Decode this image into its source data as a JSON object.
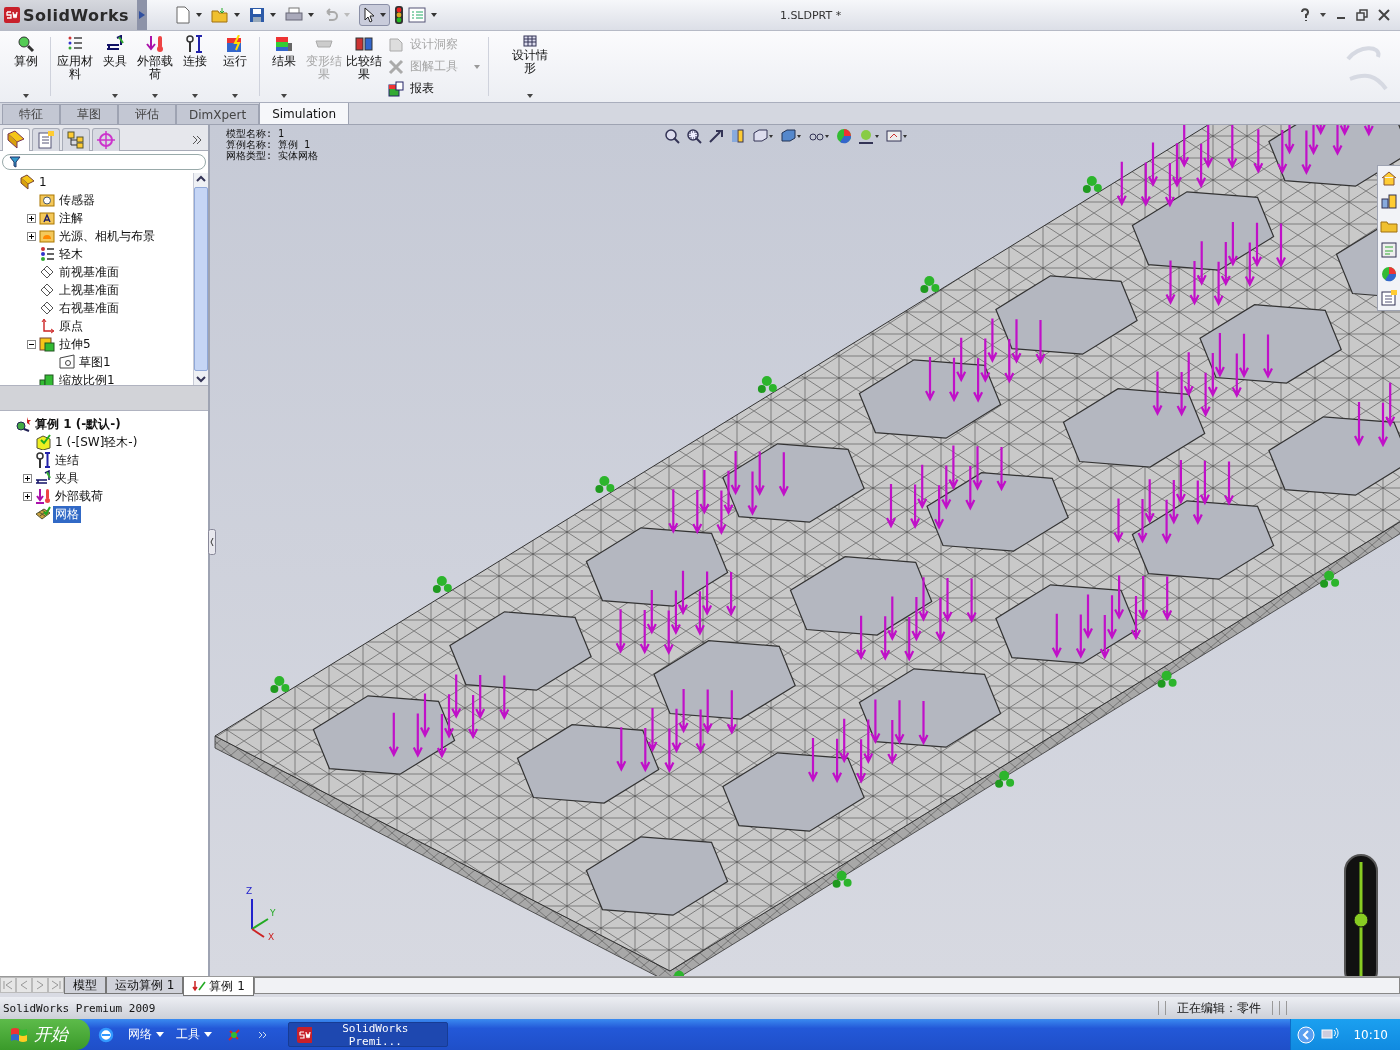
{
  "app": {
    "logo": "SolidWorks"
  },
  "window": {
    "title": "1.SLDPRT *"
  },
  "command_manager": {
    "large": [
      {
        "label": "算例",
        "dropdown": true,
        "disabled": false
      },
      {
        "label": "应用材料",
        "dropdown": false,
        "disabled": false
      },
      {
        "label": "夹具",
        "dropdown": true,
        "disabled": false
      },
      {
        "label": "外部载荷",
        "dropdown": true,
        "disabled": false
      },
      {
        "label": "连接",
        "dropdown": true,
        "disabled": false
      },
      {
        "label": "运行",
        "dropdown": true,
        "disabled": false
      },
      {
        "label": "结果",
        "dropdown": true,
        "disabled": false
      },
      {
        "label": "变形结果",
        "dropdown": false,
        "disabled": true
      },
      {
        "label": "比较结果",
        "dropdown": false,
        "disabled": false
      }
    ],
    "small": [
      {
        "label": "设计洞察",
        "dropdown": false,
        "disabled": true
      },
      {
        "label": "图解工具",
        "dropdown": true,
        "disabled": true
      },
      {
        "label": "报表",
        "dropdown": false,
        "disabled": false
      }
    ],
    "last": {
      "label": "设计情形",
      "dropdown": true,
      "disabled": false
    }
  },
  "tabs": [
    {
      "label": "特征",
      "selected": false
    },
    {
      "label": "草图",
      "selected": false
    },
    {
      "label": "评估",
      "selected": false
    },
    {
      "label": "DimXpert",
      "selected": false
    },
    {
      "label": "Simulation",
      "selected": true
    }
  ],
  "feature_tree": {
    "items": [
      {
        "label": "1",
        "kind": "part",
        "children": [
          {
            "label": "传感器",
            "kind": "sensor"
          },
          {
            "label": "注解",
            "kind": "annotation",
            "expanded": false
          },
          {
            "label": "光源、相机与布景",
            "kind": "lights",
            "expanded": false
          },
          {
            "label": "轻木",
            "kind": "material"
          },
          {
            "label": "前视基准面",
            "kind": "plane"
          },
          {
            "label": "上视基准面",
            "kind": "plane"
          },
          {
            "label": "右视基准面",
            "kind": "plane"
          },
          {
            "label": "原点",
            "kind": "origin"
          },
          {
            "label": "拉伸5",
            "kind": "extrude",
            "expanded": true,
            "children": [
              {
                "label": "草图1",
                "kind": "sketch"
              }
            ]
          },
          {
            "label": "缩放比例1",
            "kind": "scale"
          }
        ]
      }
    ]
  },
  "study_tree": {
    "items": [
      {
        "label": "算例 1 (-默认-)",
        "kind": "study",
        "selected": false,
        "children": [
          {
            "label": "1 (-[SW]轻木-)",
            "kind": "part",
            "selected": false
          },
          {
            "label": "连结",
            "kind": "connection",
            "selected": false
          },
          {
            "label": "夹具",
            "kind": "fixture",
            "expanded": false,
            "selected": false
          },
          {
            "label": "外部载荷",
            "kind": "load",
            "expanded": false,
            "selected": false
          },
          {
            "label": "网格",
            "kind": "mesh",
            "selected": true
          }
        ]
      }
    ]
  },
  "viewport": {
    "info": [
      "模型名称: 1",
      "算例名称: 算例 1",
      "网格类型: 实体网格"
    ],
    "triad": [
      "Z",
      "Y",
      "X"
    ]
  },
  "bottom_tabs": [
    {
      "label": "模型",
      "selected": false
    },
    {
      "label": "运动算例 1",
      "selected": false
    },
    {
      "label": "算例 1",
      "selected": true
    }
  ],
  "status_bar": {
    "left": "SolidWorks Premium 2009",
    "right": "正在编辑：零件"
  },
  "taskbar": {
    "start": "开始",
    "toolbars": [
      "网络",
      "工具"
    ],
    "task": "SolidWorks Premi...",
    "clock": "10:10"
  }
}
